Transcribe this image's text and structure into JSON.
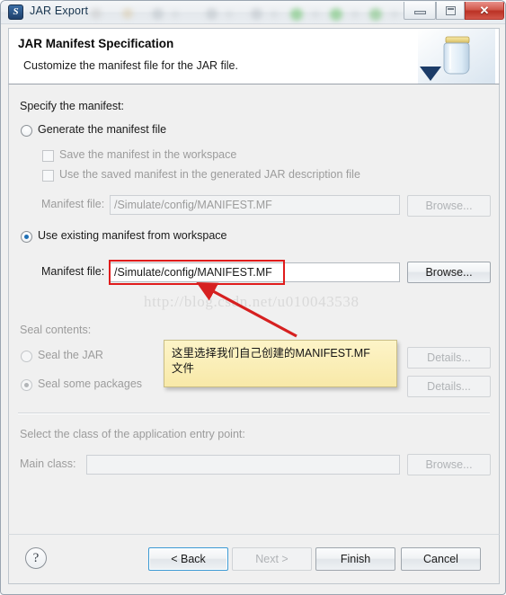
{
  "window": {
    "title": "JAR Export",
    "app_icon": "jar-export-icon",
    "controls": {
      "minimize": "minimize-button",
      "maximize": "maximize-button",
      "close_label": "✕"
    }
  },
  "header": {
    "title": "JAR Manifest Specification",
    "subtitle": "Customize the manifest file for the JAR file.",
    "image": "jar-banner-icon"
  },
  "page": {
    "specify_label": "Specify the manifest:",
    "generate_radio": {
      "label": "Generate the manifest file",
      "selected": false,
      "enabled": true
    },
    "save_checkbox": {
      "label": "Save the manifest in the workspace",
      "checked": false,
      "enabled": false
    },
    "use_saved_checkbox": {
      "label": "Use the saved manifest in the generated JAR description file",
      "checked": false,
      "enabled": false
    },
    "manifest_file_label_disabled": "Manifest file:",
    "manifest_file_value_disabled": "/Simulate/config/MANIFEST.MF",
    "browse_disabled_label": "Browse...",
    "use_existing_radio": {
      "label": "Use existing manifest from workspace",
      "selected": true,
      "enabled": true
    },
    "manifest_file_label": "Manifest file:",
    "manifest_file_value": "/Simulate/config/MANIFEST.MF",
    "browse_label": "Browse...",
    "seal_contents_label": "Seal contents:",
    "seal_jar_radio": {
      "label": "Seal the JAR",
      "selected": false,
      "enabled": false
    },
    "seal_packages_radio": {
      "label": "Seal some packages",
      "selected": true,
      "enabled": false
    },
    "details_label_1": "Details...",
    "details_label_2": "Details...",
    "entry_point_label": "Select the class of the application entry point:",
    "main_class_label": "Main class:",
    "main_class_value": "",
    "main_class_browse_label": "Browse..."
  },
  "buttonbar": {
    "help_label": "?",
    "back_label": "< Back",
    "next_label": "Next >",
    "finish_label": "Finish",
    "cancel_label": "Cancel"
  },
  "annotations": {
    "watermark": "http://blog.csdn.net/u010043538",
    "tooltip_line1": "这里选择我们自己创建的MANIFEST.MF",
    "tooltip_line2": "文件",
    "highlight_color": "#e01b1b",
    "arrow_color": "#d62020",
    "tooltip_bg": "#fbeeb0"
  }
}
